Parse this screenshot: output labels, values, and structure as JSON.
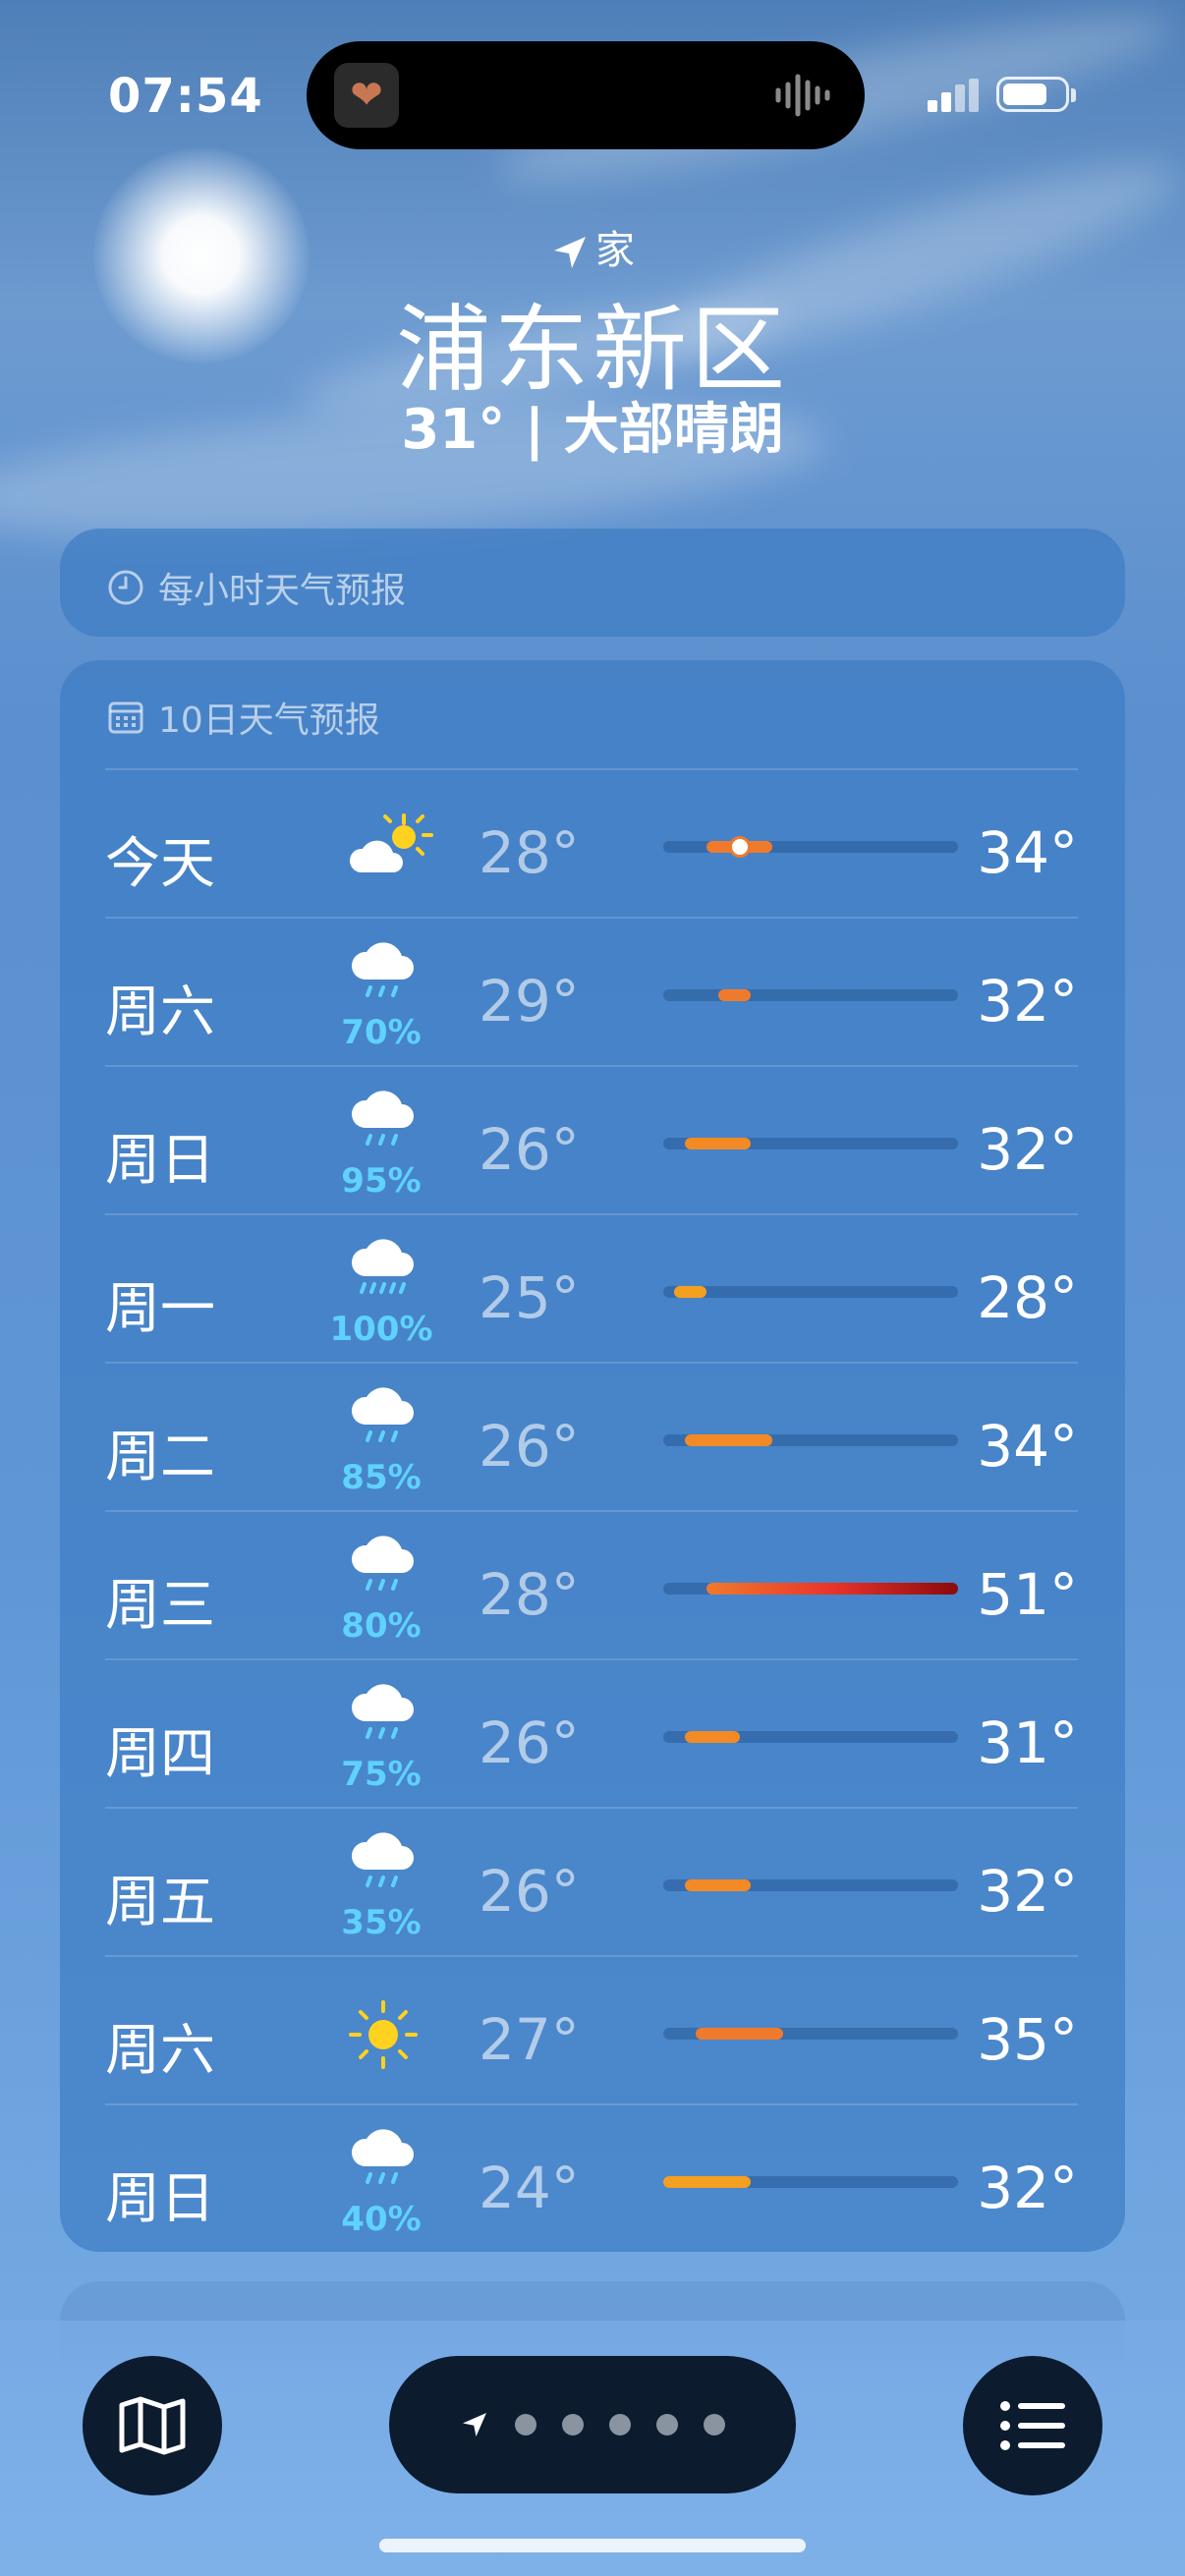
{
  "status": {
    "time": "07:54"
  },
  "header": {
    "location_label": "家",
    "city": "浦东新区",
    "current": "31° | 大部晴朗"
  },
  "hourly": {
    "title": "每小时天气预报"
  },
  "daily": {
    "title": "10日天气预报",
    "scale": {
      "min": 24,
      "max": 51
    },
    "days": [
      {
        "day": "今天",
        "icon": "partly-cloudy-sun",
        "precip": "",
        "low": "28°",
        "high": "34°",
        "low_val": 28,
        "high_val": 34,
        "current_val": 31,
        "bar_color": "#f07a2c"
      },
      {
        "day": "周六",
        "icon": "rain-cloud",
        "precip": "70%",
        "low": "29°",
        "high": "32°",
        "low_val": 29,
        "high_val": 32,
        "bar_color": "#f07a2c"
      },
      {
        "day": "周日",
        "icon": "rain-cloud",
        "precip": "95%",
        "low": "26°",
        "high": "32°",
        "low_val": 26,
        "high_val": 32,
        "bar_color": "#f28a25"
      },
      {
        "day": "周一",
        "icon": "heavy-rain-cloud",
        "precip": "100%",
        "low": "25°",
        "high": "28°",
        "low_val": 25,
        "high_val": 28,
        "bar_color": "#f3a020"
      },
      {
        "day": "周二",
        "icon": "rain-cloud",
        "precip": "85%",
        "low": "26°",
        "high": "34°",
        "low_val": 26,
        "high_val": 34,
        "bar_color": "#f28a25"
      },
      {
        "day": "周三",
        "icon": "rain-cloud",
        "precip": "80%",
        "low": "28°",
        "high": "51°",
        "low_val": 28,
        "high_val": 51,
        "bar_color": "gradient"
      },
      {
        "day": "周四",
        "icon": "rain-cloud",
        "precip": "75%",
        "low": "26°",
        "high": "31°",
        "low_val": 26,
        "high_val": 31,
        "bar_color": "#f28a25"
      },
      {
        "day": "周五",
        "icon": "rain-cloud",
        "precip": "35%",
        "low": "26°",
        "high": "32°",
        "low_val": 26,
        "high_val": 32,
        "bar_color": "#f28a25"
      },
      {
        "day": "周六",
        "icon": "sun",
        "precip": "",
        "low": "27°",
        "high": "35°",
        "low_val": 27,
        "high_val": 35,
        "bar_color": "#f07a2c"
      },
      {
        "day": "周日",
        "icon": "rain-cloud",
        "precip": "40%",
        "low": "24°",
        "high": "32°",
        "low_val": 24,
        "high_val": 32,
        "bar_color": "#f3a020"
      }
    ]
  },
  "nav": {
    "page_count": 5,
    "active_page": 0
  }
}
